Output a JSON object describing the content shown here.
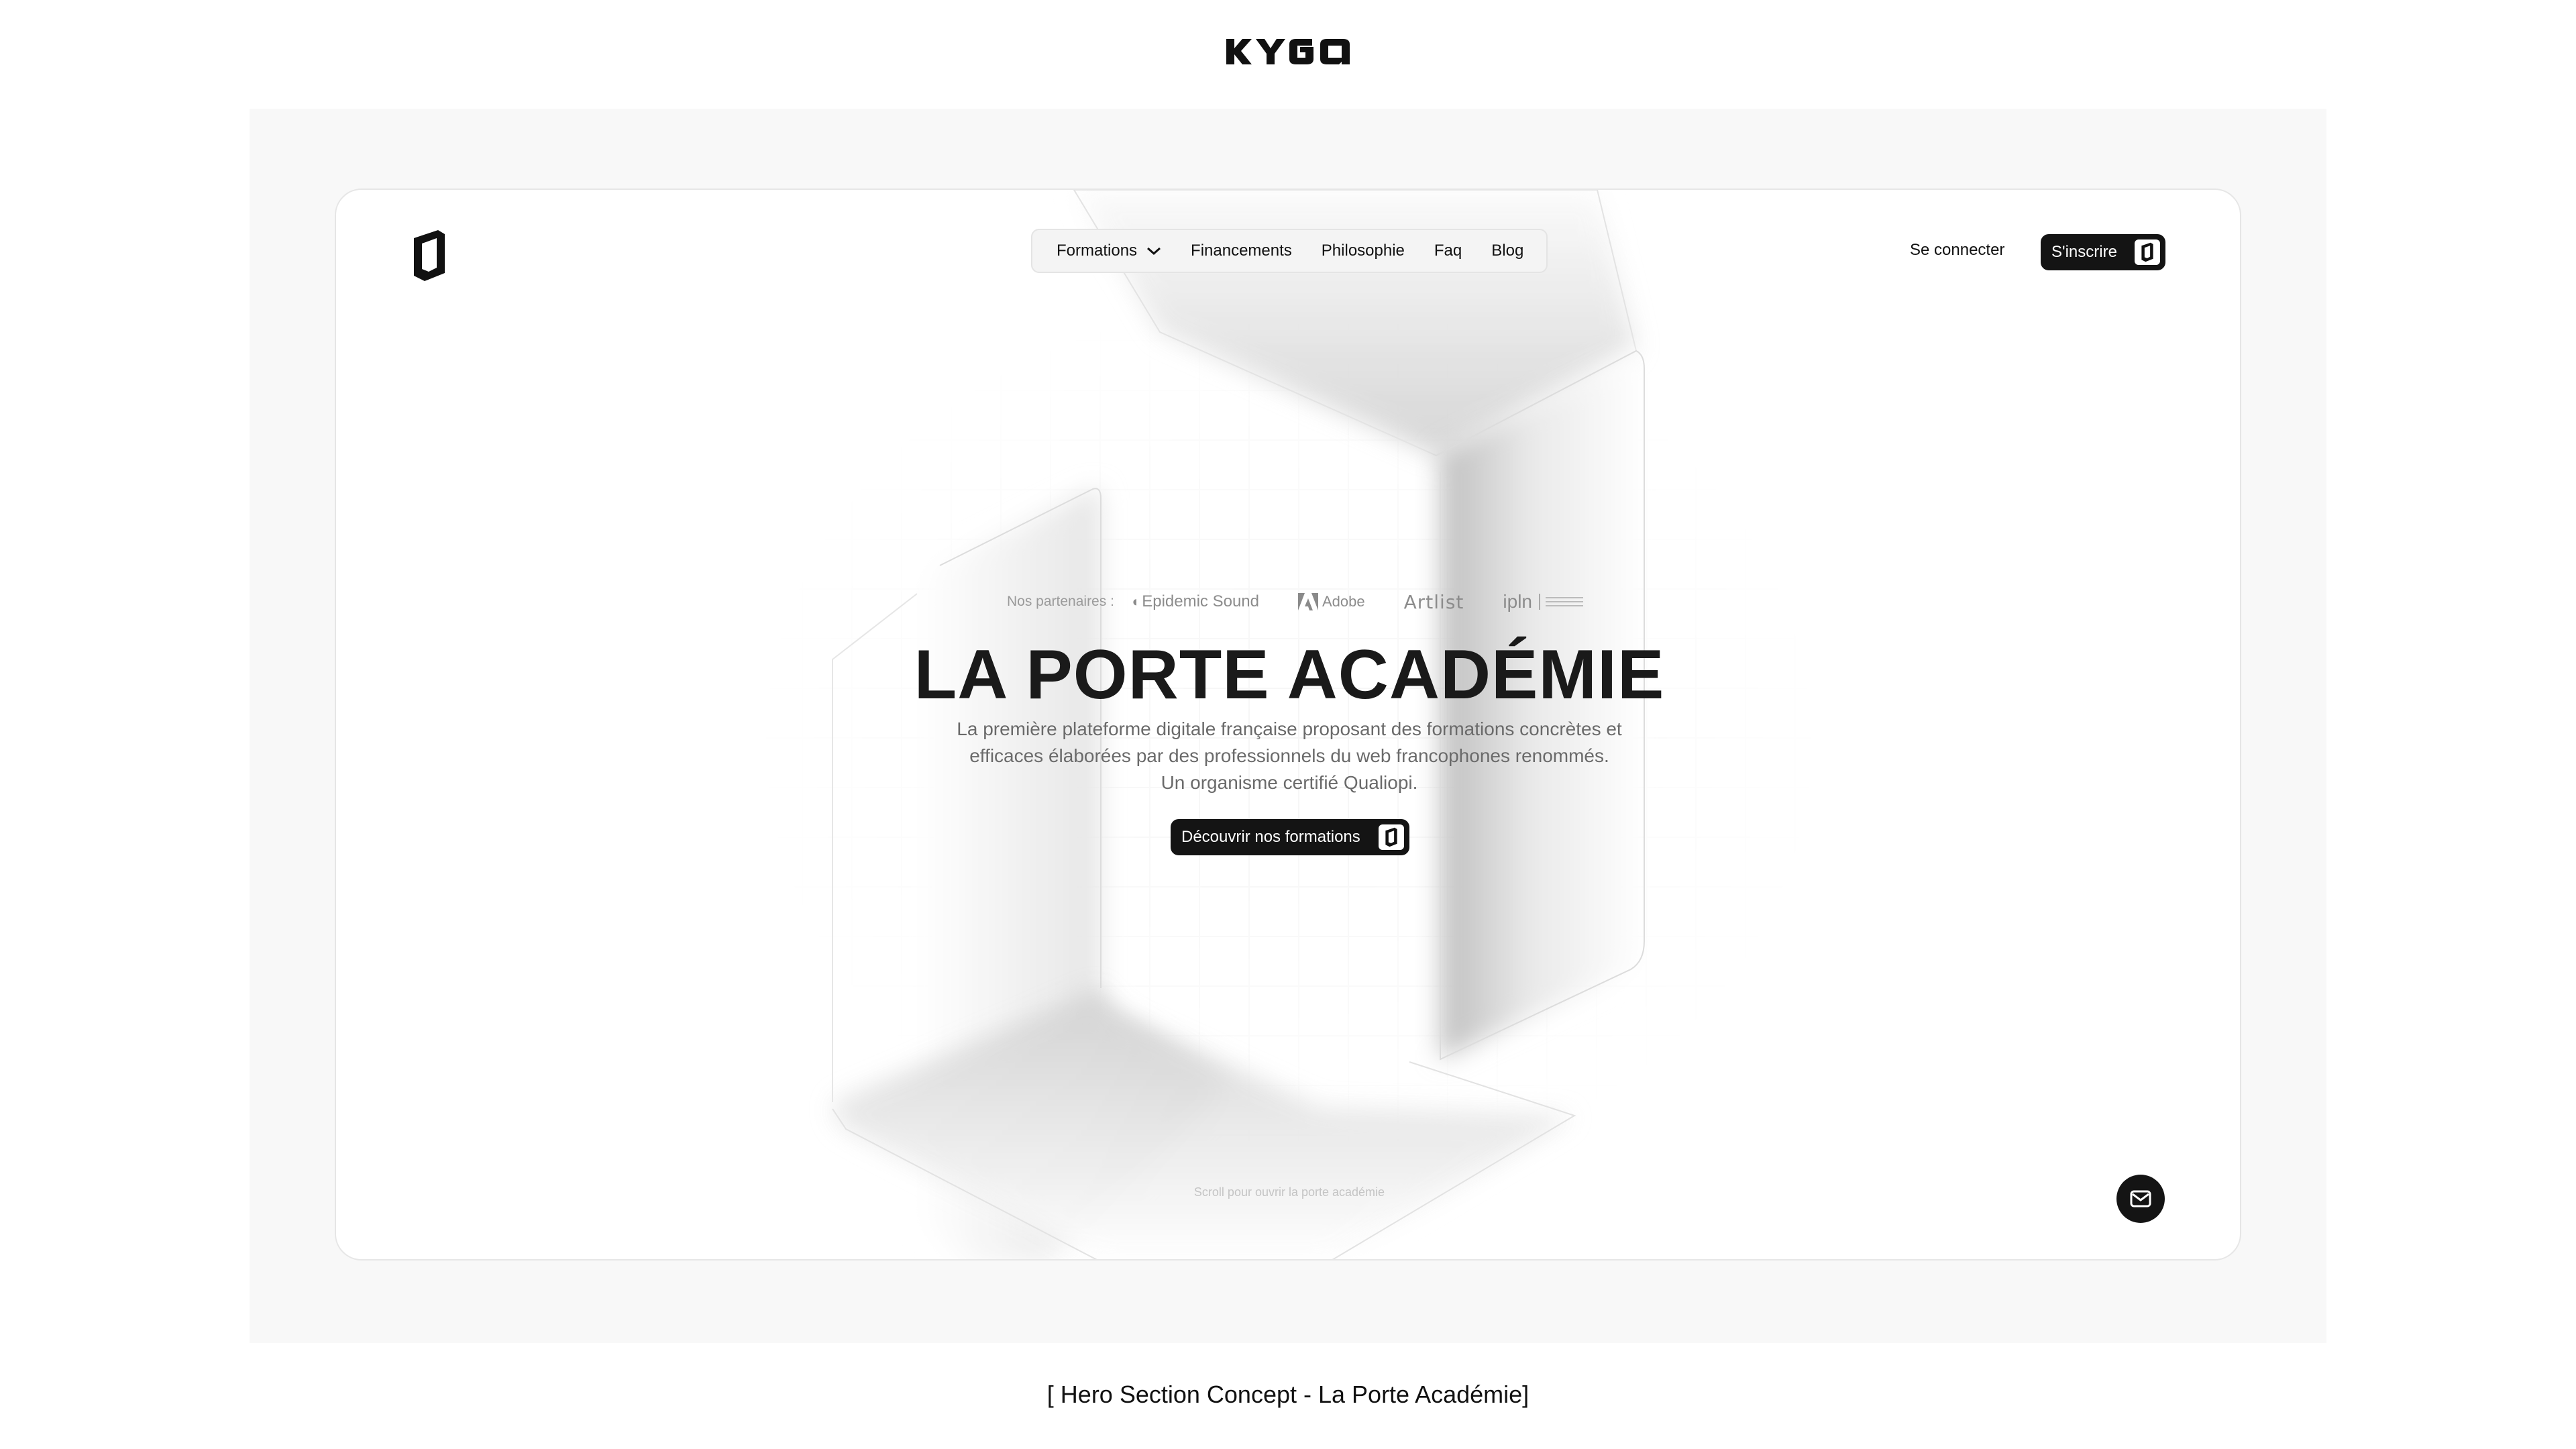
{
  "brand": {
    "wordmark": "KYGO"
  },
  "nav": {
    "items": [
      {
        "label": "Formations",
        "has_dropdown": true
      },
      {
        "label": "Financements"
      },
      {
        "label": "Philosophie"
      },
      {
        "label": "Faq"
      },
      {
        "label": "Blog"
      }
    ],
    "login_label": "Se connecter",
    "signup_label": "S'inscrire"
  },
  "hero": {
    "partners_label": "Nos partenaires :",
    "partners": [
      "Epidemic Sound",
      "Adobe",
      "Artlist",
      "ipln"
    ],
    "title": "LA PORTE ACADÉMIE",
    "subtitle_lines": [
      "La première plateforme digitale française proposant des formations concrètes et",
      "efficaces élaborées par des professionnels du web francophones renommés.",
      "Un organisme certifié Qualiopi."
    ],
    "cta_label": "Découvrir nos formations",
    "scroll_hint": "Scroll pour ouvrir la porte académie"
  },
  "caption": "[ Hero Section Concept - La Porte Académie]",
  "colors": {
    "accent": "#141414",
    "stage_bg": "#f8f8f8",
    "card_bg": "#ffffff",
    "muted_text": "#6a6a6a"
  },
  "icons": {
    "logo": "porte-logo-icon",
    "dropdown": "chevron-down-icon",
    "mail": "mail-icon"
  }
}
